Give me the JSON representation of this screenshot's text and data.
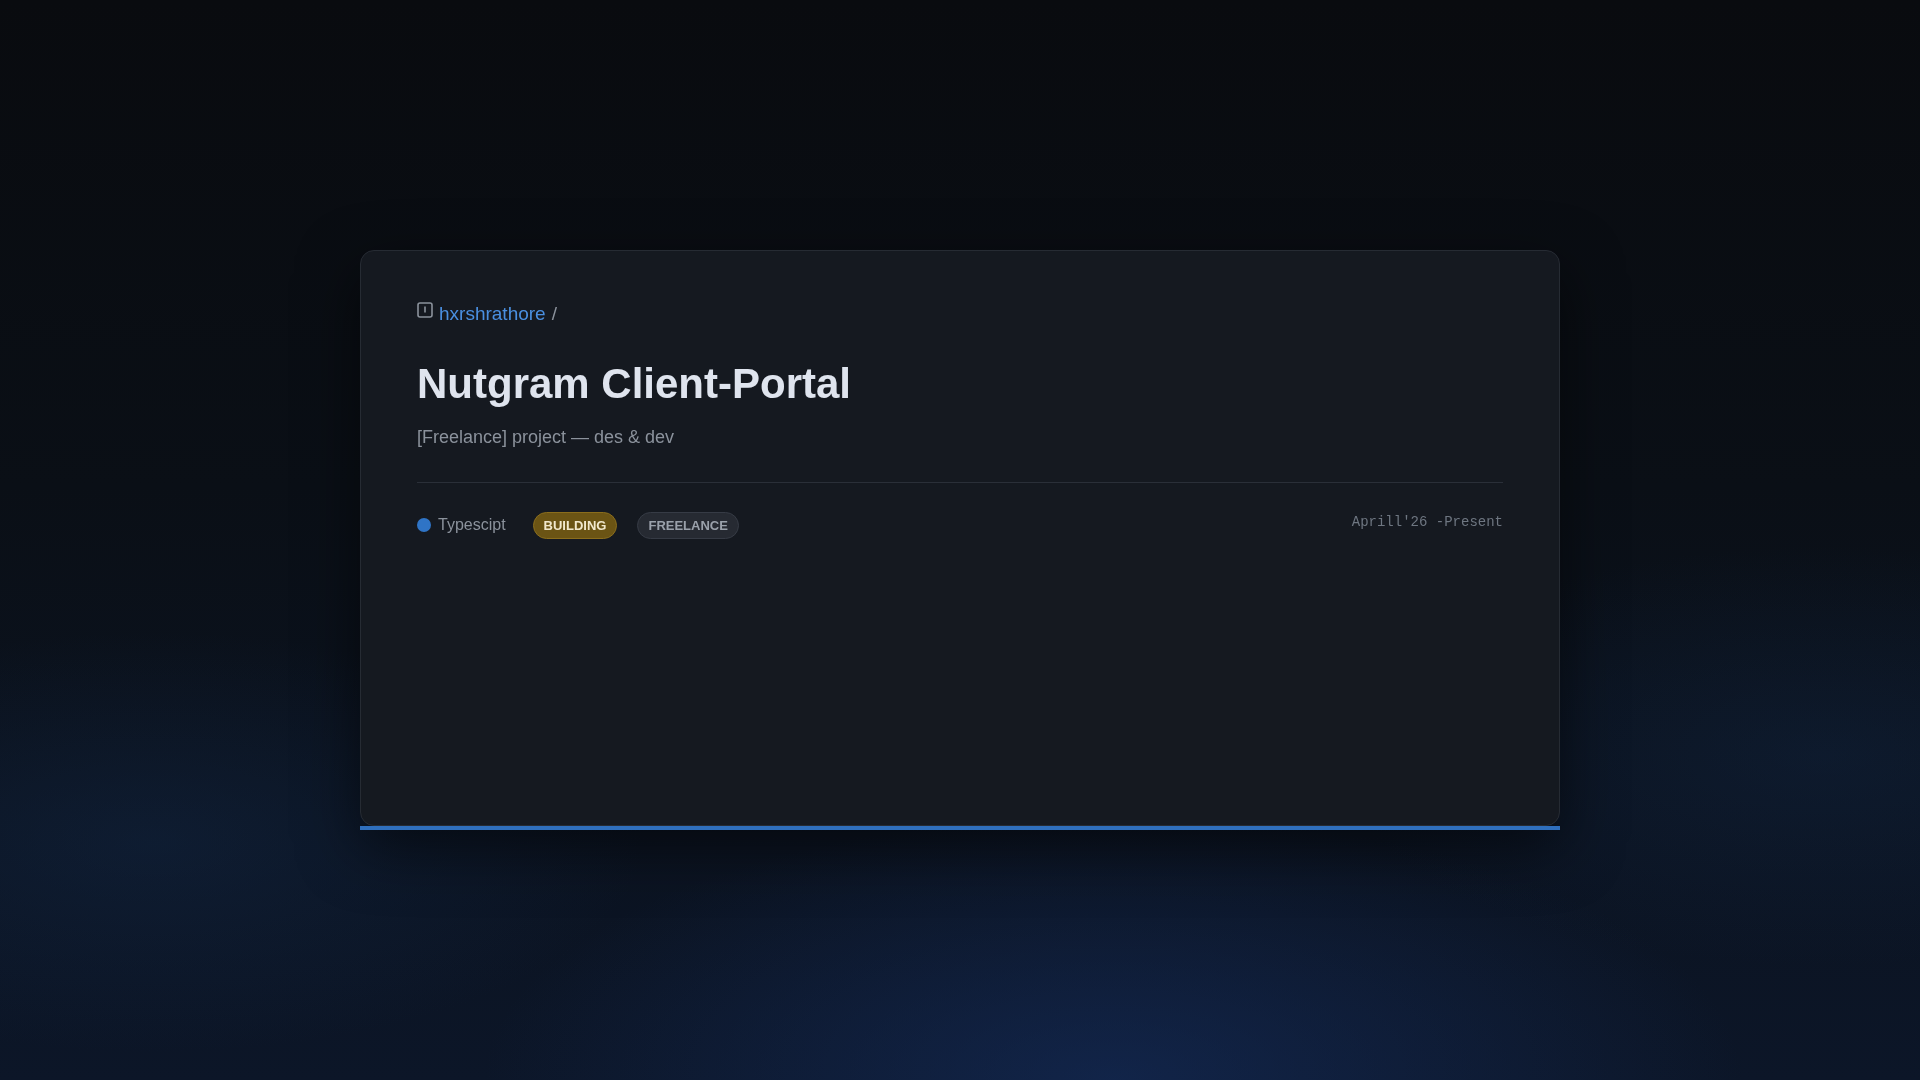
{
  "breadcrumb": {
    "owner": "hxrshrathore",
    "separator": "/"
  },
  "title": "Nutgram Client-Portal",
  "description": "[Freelance] project — des & dev",
  "language": {
    "name": "Typescipt",
    "color": "#2f74c6"
  },
  "tags": [
    {
      "label": "BUILDING",
      "kind": "status"
    },
    {
      "label": "FREELANCE",
      "kind": "category"
    }
  ],
  "period": "Aprill'26 -Present"
}
